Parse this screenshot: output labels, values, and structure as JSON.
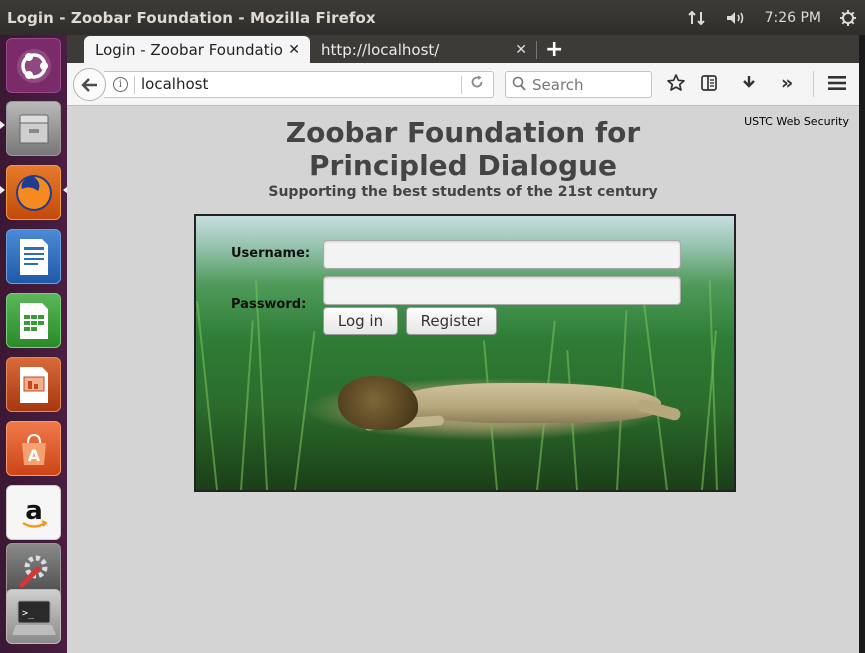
{
  "system": {
    "window_title": "Login - Zoobar Foundation - Mozilla Firefox",
    "clock": "7:26 PM",
    "icons": [
      "network-icon",
      "volume-icon",
      "power-gear-icon"
    ]
  },
  "launcher": {
    "items": [
      {
        "name": "ubuntu-dash-icon",
        "color": "#7b2a6a"
      },
      {
        "name": "files-icon",
        "color": "#8a8a8a"
      },
      {
        "name": "firefox-icon",
        "color": "#e66000"
      },
      {
        "name": "libreoffice-writer-icon",
        "color": "#2f6db5"
      },
      {
        "name": "libreoffice-calc-icon",
        "color": "#3a9a3a"
      },
      {
        "name": "libreoffice-impress-icon",
        "color": "#c24a1e"
      },
      {
        "name": "software-center-icon",
        "color": "#e2552b"
      },
      {
        "name": "amazon-icon",
        "color": "#ffffff"
      },
      {
        "name": "system-settings-icon",
        "color": "#555555"
      },
      {
        "name": "terminal-icon",
        "color": "#333333"
      }
    ]
  },
  "browser": {
    "tabs": [
      {
        "label": "Login - Zoobar Foundatio",
        "active": true
      },
      {
        "label": "http://localhost/",
        "active": false
      }
    ],
    "url": "localhost",
    "search_placeholder": "Search"
  },
  "page": {
    "corner_label": "USTC Web Security",
    "title_line1": "Zoobar Foundation for",
    "title_line2": "Principled Dialogue",
    "subtitle": "Supporting the best students of the 21st century",
    "form": {
      "username_label": "Username:",
      "password_label": "Password:",
      "username_value": "",
      "password_value": "",
      "login_label": "Log in",
      "register_label": "Register"
    }
  }
}
